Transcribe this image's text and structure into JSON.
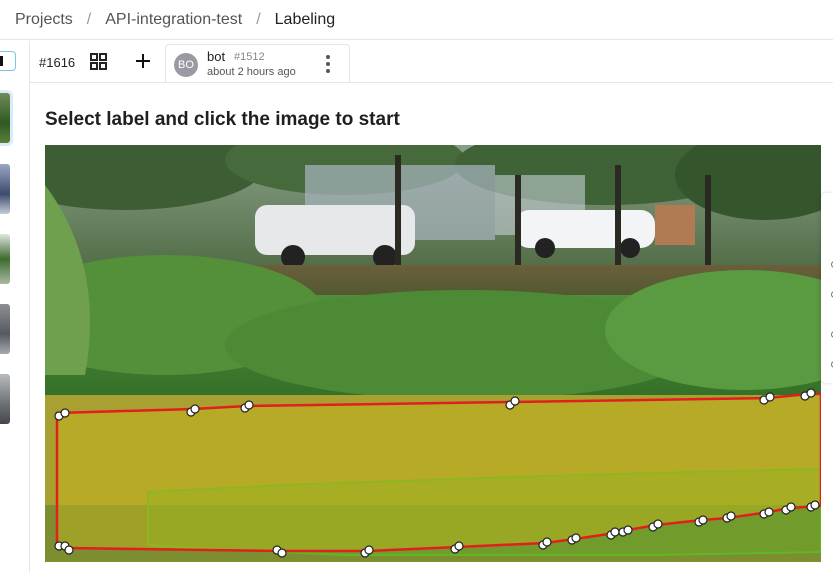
{
  "breadcrumb": {
    "items": [
      "Projects",
      "API-integration-test",
      "Labeling"
    ],
    "separator": "/"
  },
  "toolbar": {
    "task_id": "#1616",
    "grid_icon": "grid-icon",
    "add_icon": "plus-icon",
    "annotation": {
      "avatar_initials": "BO",
      "user": "bot",
      "id": "#1512",
      "time": "about 2 hours ago",
      "menu_icon": "kebab-menu-icon"
    }
  },
  "main": {
    "instruction": "Select label and click the image to start"
  },
  "colors": {
    "accent": "#7cc3ec",
    "region_red": "#e21f1f",
    "region_green": "#5fb822"
  }
}
